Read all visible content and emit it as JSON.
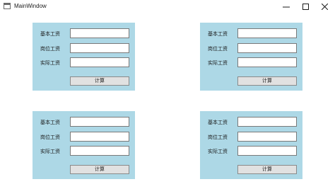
{
  "window": {
    "title": "MainWindow",
    "controls": {
      "minimize_icon": "minimize-icon",
      "maximize_icon": "maximize-icon",
      "close_icon": "close-icon"
    }
  },
  "colors": {
    "panel_background": "#add8e6",
    "button_background": "#e1e1e1",
    "field_background": "#ffffff"
  },
  "panels": [
    {
      "labels": [
        "基本工资",
        "岗位工资",
        "实际工资"
      ],
      "values": [
        "",
        "",
        ""
      ],
      "button_label": "计算"
    },
    {
      "labels": [
        "基本工资",
        "岗位工资",
        "实际工资"
      ],
      "values": [
        "",
        "",
        ""
      ],
      "button_label": "计算"
    },
    {
      "labels": [
        "基本工资",
        "岗位工资",
        "实际工资"
      ],
      "values": [
        "",
        "",
        ""
      ],
      "button_label": "计算"
    },
    {
      "labels": [
        "基本工资",
        "岗位工资",
        "实际工资"
      ],
      "values": [
        "",
        "",
        ""
      ],
      "button_label": "计算"
    }
  ]
}
